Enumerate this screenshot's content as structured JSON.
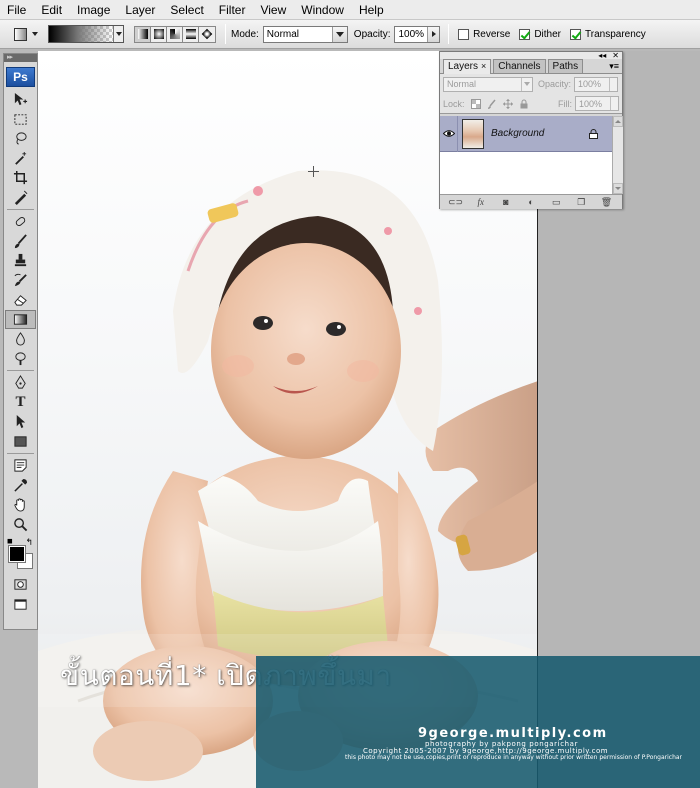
{
  "menu": [
    "File",
    "Edit",
    "Image",
    "Layer",
    "Select",
    "Filter",
    "View",
    "Window",
    "Help"
  ],
  "options": {
    "mode_label": "Mode:",
    "mode_value": "Normal",
    "opacity_label": "Opacity:",
    "opacity_value": "100%",
    "reverse_label": "Reverse",
    "reverse_checked": false,
    "dither_label": "Dither",
    "dither_checked": true,
    "transparency_label": "Transparency",
    "transparency_checked": true
  },
  "tools": {
    "logo": "Ps",
    "active": "gradient-tool",
    "foreground_color": "#000000",
    "background_color": "#ffffff"
  },
  "layers_panel": {
    "tabs": [
      "Layers",
      "Channels",
      "Paths"
    ],
    "active_tab": "Layers",
    "blend_mode": "Normal",
    "opacity_label": "Opacity:",
    "opacity_value": "100%",
    "lock_label": "Lock:",
    "fill_label": "Fill:",
    "fill_value": "100%",
    "layer_name": "Background",
    "selected_row_color": "#a9adc8"
  },
  "canvas": {
    "caption": "ขั้นตอนที่1*  เปิดภาพขึ้นมา",
    "watermark_site": "9george.multiply.com",
    "watermark_line1": "photography by pakpong pongarichar",
    "watermark_line2": "Copyright 2005-2007 by 9george,http://9george.multiply.com",
    "watermark_line3": "this photo may not be use,copies,print or reproduce in anyway without prior written permission of P.Pongarichar",
    "watermark_color": "#175a6e"
  }
}
